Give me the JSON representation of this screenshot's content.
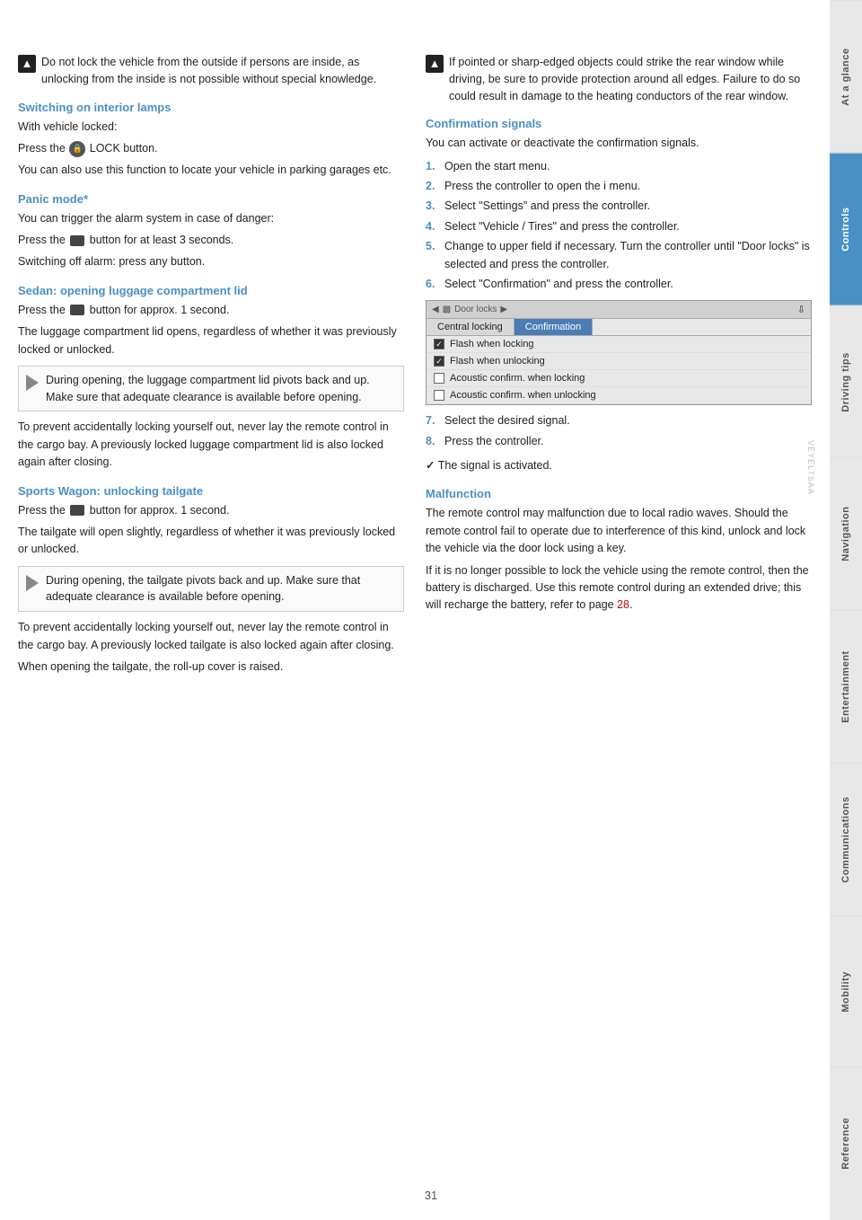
{
  "sidebar": {
    "tabs": [
      {
        "label": "At a glance",
        "active": false
      },
      {
        "label": "Controls",
        "active": true
      },
      {
        "label": "Driving tips",
        "active": false
      },
      {
        "label": "Navigation",
        "active": false
      },
      {
        "label": "Entertainment",
        "active": false
      },
      {
        "label": "Communications",
        "active": false
      },
      {
        "label": "Mobility",
        "active": false
      },
      {
        "label": "Reference",
        "active": false
      }
    ]
  },
  "page_number": "31",
  "left_column": {
    "warning1": {
      "text": "Do not lock the vehicle from the outside if persons are inside, as unlocking from the inside is not possible without special knowledge."
    },
    "switching_heading": "Switching on interior lamps",
    "switching_text1": "With vehicle locked:",
    "switching_text2": "Press the Ⓛ LOCK button.",
    "switching_text3": "You can also use this function to locate your vehicle in parking garages etc.",
    "panic_heading": "Panic mode*",
    "panic_text1": "You can trigger the alarm system in case of danger:",
    "panic_text2": "Press the ■ button for at least 3 seconds.",
    "panic_text3": "Switching off alarm: press any button.",
    "sedan_heading": "Sedan: opening luggage compartment lid",
    "sedan_text1": "Press the ■ button for approx. 1 second.",
    "sedan_text2": "The luggage compartment lid opens, regardless of whether it was previously locked or unlocked.",
    "sedan_note": "During opening, the luggage compartment lid pivots back and up. Make sure that adequate clearance is available before opening.",
    "sedan_text3": "To prevent accidentally locking yourself out, never lay the remote control in the cargo bay. A previously locked luggage compartment lid is also locked again after closing.",
    "sports_heading": "Sports Wagon: unlocking tailgate",
    "sports_text1": "Press the ■ button for approx. 1 second.",
    "sports_text2": "The tailgate will open slightly, regardless of whether it was previously locked or unlocked.",
    "sports_note": "During opening, the tailgate pivots back and up. Make sure that adequate clearance is available before opening.",
    "sports_text3": "To prevent accidentally locking yourself out, never lay the remote control in the cargo bay. A previously locked tailgate is also locked again after closing.",
    "sports_text4": "When opening the tailgate, the roll-up cover is raised."
  },
  "right_column": {
    "warning1": {
      "text": "If pointed or sharp-edged objects could strike the rear window while driving, be sure to provide protection around all edges. Failure to do so could result in damage to the heating conductors of the rear window."
    },
    "confirmation_heading": "Confirmation signals",
    "confirmation_text": "You can activate or deactivate the confirmation signals.",
    "steps": [
      {
        "num": "1.",
        "text": "Open the start menu."
      },
      {
        "num": "2.",
        "text": "Press the controller to open the і menu."
      },
      {
        "num": "3.",
        "text": "Select \"Settings\" and press the controller."
      },
      {
        "num": "4.",
        "text": "Select \"Vehicle / Tires\" and press the controller."
      },
      {
        "num": "5.",
        "text": "Change to upper field if necessary. Turn the controller until \"Door locks\" is selected and press the controller."
      },
      {
        "num": "6.",
        "text": "Select \"Confirmation\" and press the controller."
      }
    ],
    "ui": {
      "title": "Door locks",
      "tabs": [
        "Central locking",
        "Confirmation"
      ],
      "active_tab": "Confirmation",
      "menu_items": [
        {
          "label": "Flash when locking",
          "checked": true
        },
        {
          "label": "Flash when unlocking",
          "checked": true
        },
        {
          "label": "Acoustic confirm. when locking",
          "checked": false
        },
        {
          "label": "Acoustic confirm. when unlocking",
          "checked": false
        }
      ]
    },
    "steps_after": [
      {
        "num": "7.",
        "text": "Select the desired signal."
      },
      {
        "num": "8.",
        "text": "Press the controller."
      }
    ],
    "check_text": "The signal is activated.",
    "malfunction_heading": "Malfunction",
    "malfunction_text1": "The remote control may malfunction due to local radio waves. Should the remote control fail to operate due to interference of this kind, unlock and lock the vehicle via the door lock using a key.",
    "malfunction_text2": "If it is no longer possible to lock the vehicle using the remote control, then the battery is discharged. Use this remote control during an extended drive; this will recharge the battery, refer to page 28."
  },
  "watermark": "VEYELTSAA"
}
